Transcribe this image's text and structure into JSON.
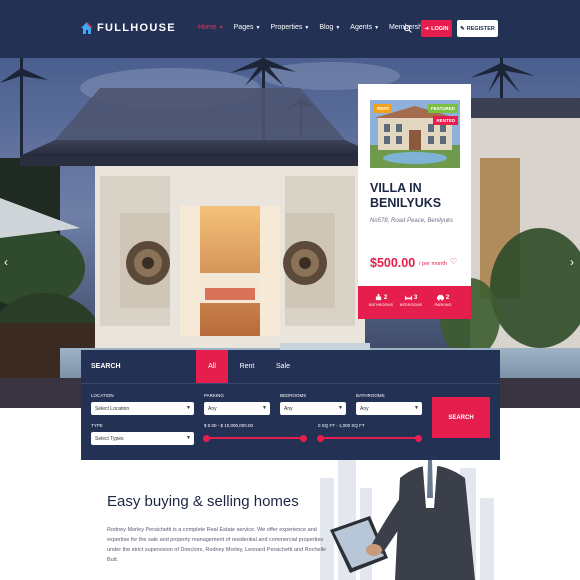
{
  "header": {
    "logo_text": "FULLHOUSE",
    "nav": [
      {
        "label": "Home",
        "dropdown": true,
        "active": true
      },
      {
        "label": "Pages",
        "dropdown": true,
        "active": false
      },
      {
        "label": "Properties",
        "dropdown": true,
        "active": false
      },
      {
        "label": "Blog",
        "dropdown": true,
        "active": false
      },
      {
        "label": "Agents",
        "dropdown": true,
        "active": false
      },
      {
        "label": "Membership",
        "dropdown": false,
        "active": false
      }
    ],
    "login_label": "LOGIN",
    "register_label": "REGISTER"
  },
  "property_card": {
    "badges": {
      "left": "RENT",
      "featured": "FEATURED",
      "rented": "RENTED"
    },
    "title": "VILLA IN BENILYUKS",
    "address": "No578, Road Peace, Benilyuks",
    "price": "$500.00",
    "price_period": "/ per month",
    "features": [
      {
        "value": "2",
        "label": "BATHROOMS",
        "icon": "bath-icon"
      },
      {
        "value": "3",
        "label": "BEDROOMS",
        "icon": "bed-icon"
      },
      {
        "value": "2",
        "label": "PARKING",
        "icon": "car-icon"
      }
    ]
  },
  "search": {
    "heading": "SEARCH",
    "tabs": [
      "All",
      "Rent",
      "Sale"
    ],
    "active_tab": "All",
    "fields": {
      "location": {
        "label": "LOCATION",
        "value": "Select Location"
      },
      "parking": {
        "label": "PARKING",
        "value": "Any"
      },
      "bedrooms": {
        "label": "BEDROOMS",
        "value": "Any"
      },
      "bathrooms": {
        "label": "BATHROOMS",
        "value": "Any"
      },
      "type": {
        "label": "TYPE",
        "value": "Select Types"
      }
    },
    "price_range": "$ 0.00 - $ 10,000,000.00",
    "area_range": "0 SQ FT - 1,000 SQ FT",
    "button_label": "SEARCH"
  },
  "about": {
    "title": "Easy buying & selling homes",
    "text": "Rodney Morley Persichetti is a complete Real Estate service. We offer experience and expertise for the sale and property management of residential and commercial properties under the strict supervision of Directors, Rodney Morley, Leonard Persichetti and Rochelle Butt."
  },
  "colors": {
    "navy": "#233154",
    "accent": "#e61e4d"
  }
}
